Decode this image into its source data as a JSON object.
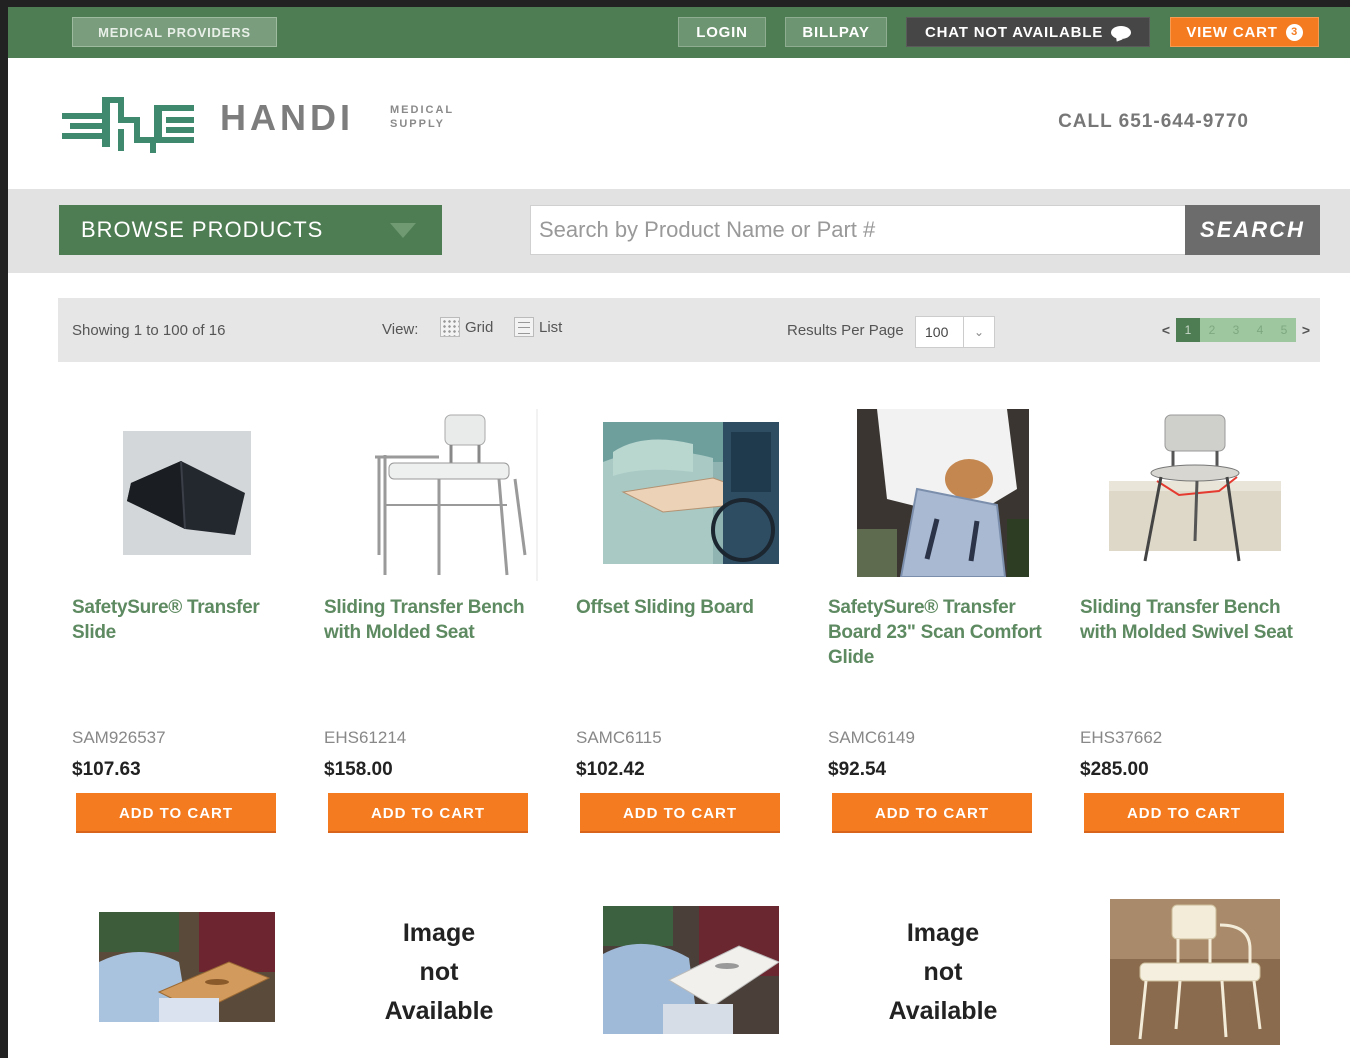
{
  "topbar": {
    "providers": "MEDICAL PROVIDERS",
    "login": "LOGIN",
    "billpay": "BILLPAY",
    "chat": "CHAT NOT AVAILABLE",
    "cart": "VIEW CART",
    "cart_count": "3"
  },
  "header": {
    "brand": "HANDI",
    "brand_sub_1": "MEDICAL",
    "brand_sub_2": "SUPPLY",
    "phone": "CALL 651-644-9770"
  },
  "browse": {
    "label": "BROWSE PRODUCTS"
  },
  "search": {
    "placeholder": "Search by Product Name or Part #",
    "button": "SEARCH"
  },
  "results": {
    "showing": "Showing 1 to 100 of 16",
    "view_label": "View:",
    "grid": "Grid",
    "list": "List",
    "per_page_label": "Results Per Page",
    "per_page_value": "100",
    "prev": "<",
    "next": ">",
    "pages": [
      "1",
      "2",
      "3",
      "4",
      "5"
    ],
    "active_page": "1"
  },
  "products": [
    {
      "name": "SafetySure® Transfer Slide",
      "sku": "SAM926537",
      "price": "$107.63",
      "cart": "ADD TO CART",
      "image": "black-slide-cushion"
    },
    {
      "name": "Sliding Transfer Bench with Molded Seat",
      "sku": "EHS61214",
      "price": "$158.00",
      "cart": "ADD TO CART",
      "image": "transfer-bench"
    },
    {
      "name": "Offset Sliding Board",
      "sku": "SAMC6115",
      "price": "$102.42",
      "cart": "ADD TO CART",
      "image": "sliding-board-bed-wheelchair"
    },
    {
      "name": "SafetySure® Transfer Board 23\" Scan Comfort Glide",
      "sku": "SAMC6149",
      "price": "$92.54",
      "cart": "ADD TO CART",
      "image": "transfer-board-in-use"
    },
    {
      "name": "Sliding Transfer Bench with Molded Swivel Seat",
      "sku": "EHS37662",
      "price": "$285.00",
      "cart": "ADD TO CART",
      "image": "swivel-bench-tub"
    }
  ],
  "row2": {
    "na_line1": "Image",
    "na_line2": "not",
    "na_line3": "Available"
  },
  "colors": {
    "green": "#4f7d53",
    "orange": "#f47b20",
    "link_green": "#5e8a61"
  }
}
